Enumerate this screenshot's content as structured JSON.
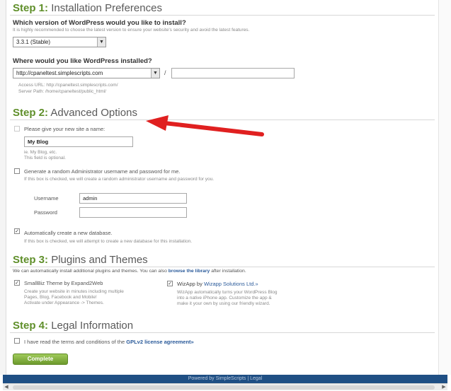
{
  "step1": {
    "num": "Step 1:",
    "title": "Installation Preferences",
    "version_question": "Which version of WordPress would you like to install?",
    "version_help": "It is highly recommended to choose the latest version to ensure your website's security and avoid the latest features.",
    "version_selected": "3.3.1 (Stable)",
    "location_question": "Where would you like WordPress installed?",
    "domain_selected": "http://cpaneltest.simplescripts.com",
    "path_separator": "/",
    "path_value": "",
    "access_url": "Access URL: http://cpaneltest.simplescripts.com/",
    "server_path": "Server Path: /home/cpaneltest/public_html/"
  },
  "step2": {
    "num": "Step 2:",
    "title": "Advanced Options",
    "site_name_label": "Please give your new site a name:",
    "site_name_value": "My Blog",
    "site_name_help_1": "ie. My Blog, etc.",
    "site_name_help_2": "This field is optional.",
    "random_admin_label": "Generate a random Administrator username and password for me.",
    "random_admin_help": "If this box is checked, we will create a random administrator username and password for you.",
    "username_label": "Username",
    "username_value": "admin",
    "password_label": "Password",
    "password_value": "",
    "auto_db_label": "Automatically create a new database.",
    "auto_db_help": "If this box is checked, we will attempt to create a new database for this installation.",
    "auto_db_checked": "✓"
  },
  "step3": {
    "num": "Step 3:",
    "title": "Plugins and Themes",
    "intro": "We can automatically install additional plugins and themes. You can also",
    "intro_link": "browse the library",
    "intro_tail": "after installation.",
    "plugin1_check": "✓",
    "plugin1_name": "SmallBiz Theme by Expand2Web",
    "plugin1_desc_1": "Create your website in minutes including multiple",
    "plugin1_desc_2": "Pages, Blog, Facebook and Mobile!",
    "plugin1_desc_3": "Activate under Appearance -> Themes.",
    "plugin2_check": "✓",
    "plugin2_name": "WizApp by",
    "plugin2_by": "Wizapp Solutions Ltd.»",
    "plugin2_desc_1": "WizApp automatically turns your WordPress Blog",
    "plugin2_desc_2": "into a native iPhone app. Customize the app &",
    "plugin2_desc_3": "make it your own by using our friendly wizard."
  },
  "step4": {
    "num": "Step 4:",
    "title": "Legal Information",
    "terms_text": "I have read the terms and conditions of the",
    "terms_link": "GPLv2 license agreement»"
  },
  "complete_label": "Complete",
  "footer_text": "Powered by SimpleScripts | Legal",
  "colors": {
    "step_green": "#5f8f2a",
    "link_blue": "#2a5a9a",
    "footer_bg": "#1f4f84",
    "annotation_arrow": "#e02020"
  },
  "icons": {
    "dropdown": "chevron-down-icon",
    "annotation": "red-arrow-annotation"
  }
}
